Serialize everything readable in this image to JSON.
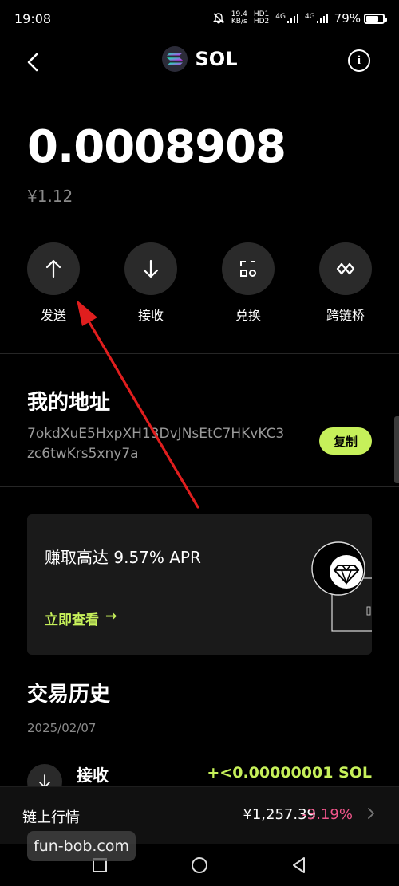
{
  "status_bar": {
    "time": "19:08",
    "net_speed_value": "19.4",
    "net_speed_unit": "KB/s",
    "hd_top": "HD1",
    "hd_bottom": "HD2",
    "sim1": "4G",
    "sim2": "4G",
    "battery": "79%",
    "battery_level": 0.79
  },
  "header": {
    "title": "SOL",
    "back_icon": "back-arrow-icon",
    "info_icon": "info-icon",
    "info_glyph": "i"
  },
  "balance": {
    "amount": "0.0008908",
    "fiat": "¥1.12"
  },
  "actions": [
    {
      "label": "发送",
      "icon": "arrow-up-icon"
    },
    {
      "label": "接收",
      "icon": "arrow-down-icon"
    },
    {
      "label": "兑换",
      "icon": "swap-icon"
    },
    {
      "label": "跨链桥",
      "icon": "bridge-icon"
    }
  ],
  "address": {
    "title": "我的地址",
    "value": "7okdXuE5HxpXH13DvJNsEtC7HKvKC3zc6twKrs5xny7a",
    "copy_label": "复制"
  },
  "promo": {
    "title": "赚取高达 9.57% APR",
    "link": "立即查看",
    "link_arrow": "→",
    "art_icon": "diamond-icon"
  },
  "history": {
    "title": "交易历史",
    "date": "2025/02/07",
    "items": [
      {
        "label": "接收",
        "amount": "+<0.00000001 SOL",
        "icon": "arrow-down-icon"
      }
    ]
  },
  "market": {
    "label": "链上行情",
    "price": "¥1,257.39",
    "change": "-3.19%"
  },
  "watermark": "fun-bob.com",
  "colors": {
    "accent": "#c6f05a",
    "negative": "#f0558a",
    "annotation_arrow": "#e01e1e"
  }
}
